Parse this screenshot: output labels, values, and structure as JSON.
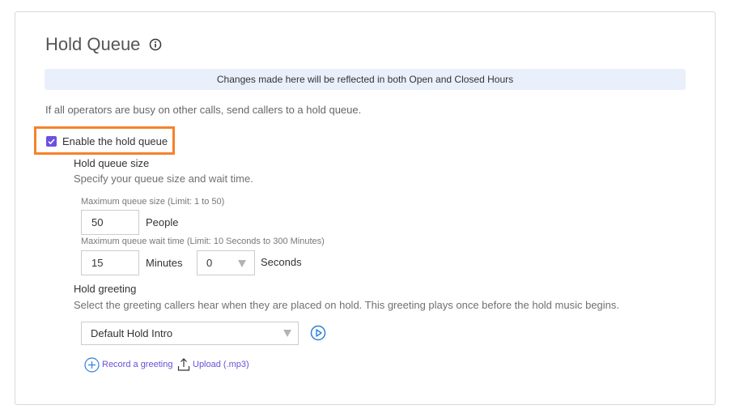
{
  "page": {
    "title": "Hold Queue",
    "banner": "Changes made here will be reflected in both Open and Closed Hours",
    "description": "If all operators are busy on other calls, send callers to a hold queue.",
    "enable_checkbox": {
      "label": "Enable the hold queue",
      "checked": true
    }
  },
  "queue_size": {
    "title": "Hold queue size",
    "subtitle": "Specify your queue size and wait time.",
    "max_size_label": "Maximum queue size (Limit: 1 to 50)",
    "max_size_value": "50",
    "max_size_unit": "People",
    "max_wait_label": "Maximum queue wait time (Limit: 10 Seconds to 300 Minutes)",
    "wait_minutes_value": "15",
    "minutes_unit": "Minutes",
    "wait_seconds_value": "0",
    "seconds_unit": "Seconds"
  },
  "greeting": {
    "title": "Hold greeting",
    "subtitle": "Select the greeting callers hear when they are placed on hold. This greeting plays once before the hold music begins.",
    "selected": "Default Hold Intro",
    "record_label": "Record a greeting",
    "upload_label": "Upload (.mp3)"
  },
  "colors": {
    "accent": "#6d4fe0",
    "highlight": "#f7812b",
    "banner_bg": "#eaf0fb",
    "play_icon": "#2f7fd8"
  },
  "icons": [
    "info-icon",
    "check-icon",
    "chevron-down-icon",
    "play-icon",
    "plus-circle-icon",
    "upload-icon"
  ]
}
